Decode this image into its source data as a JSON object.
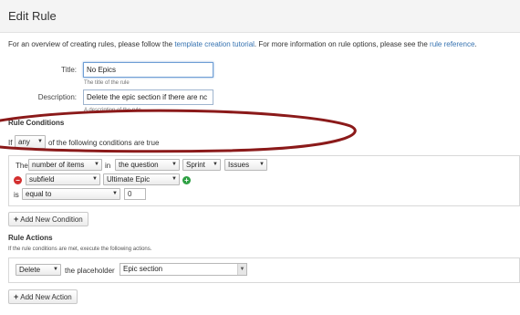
{
  "header": {
    "title": "Edit Rule"
  },
  "intro": {
    "text_before": "For an overview of creating rules, please follow the ",
    "link1": "template creation tutorial",
    "text_middle": ". For more information on rule options, please see the ",
    "link2": "rule reference",
    "text_after": "."
  },
  "form": {
    "title_label": "Title:",
    "title_value": "No Epics",
    "title_hint": "The title of the rule",
    "description_label": "Description:",
    "description_value": "Delete the epic section if there are nc",
    "description_hint": "A description of the rule"
  },
  "conditions": {
    "heading": "Rule Conditions",
    "if_label": "If",
    "match_value": "any",
    "match_suffix": "of the following conditions are true",
    "row1": {
      "the": "The",
      "field": "number of items",
      "in": "in",
      "source": "the question",
      "sprint": "Sprint",
      "issues": "Issues"
    },
    "row2": {
      "subfield": "subfield",
      "value": "Ultimate Epic"
    },
    "row3": {
      "is": "is",
      "operator": "equal to",
      "number": "0"
    },
    "add_button": "Add New Condition"
  },
  "actions": {
    "heading": "Rule Actions",
    "help": "If the rule conditions are met, execute the following actions.",
    "action_value": "Delete",
    "the_placeholder": "the placeholder",
    "placeholder_value": "Epic section",
    "add_button": "Add New Action"
  },
  "icons": {
    "remove": "minus-circle-icon",
    "add": "plus-circle-icon",
    "caret": "caret-down-icon"
  },
  "colors": {
    "link": "#3572b0",
    "annotation": "#8b1a1a",
    "remove": "#d32f2f",
    "add": "#2ea043"
  }
}
